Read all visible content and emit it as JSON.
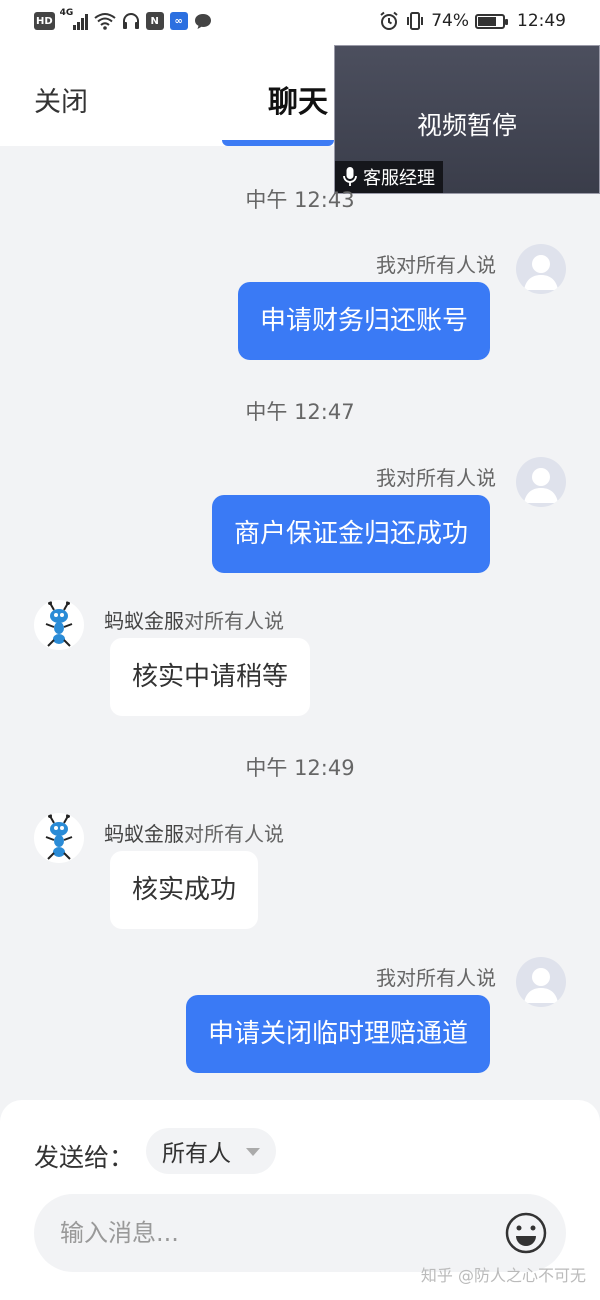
{
  "status_bar": {
    "hd": "HD",
    "net": "4G",
    "nfc": "N",
    "battery_percent": "74%",
    "battery_level": 0.74,
    "time": "12:49"
  },
  "header": {
    "close_label": "关闭",
    "title": "聊天"
  },
  "video": {
    "status": "视频暂停",
    "caption": "客服经理"
  },
  "messages": [
    {
      "type": "time",
      "text": "中午 12:43"
    },
    {
      "type": "self",
      "sender": "我对所有人说",
      "text": "申请财务归还账号"
    },
    {
      "type": "time",
      "text": "中午 12:47"
    },
    {
      "type": "self",
      "sender": "我对所有人说",
      "text": "商户保证金归还成功"
    },
    {
      "type": "other",
      "name": "蚂蚁金服",
      "suffix": "对所有人说",
      "text": "核实中请稍等"
    },
    {
      "type": "time",
      "text": "中午 12:49"
    },
    {
      "type": "other",
      "name": "蚂蚁金服",
      "suffix": "对所有人说",
      "text": "核实成功"
    },
    {
      "type": "self",
      "sender": "我对所有人说",
      "text": "申请关闭临时理赔通道"
    }
  ],
  "composer": {
    "send_to_label": "发送给：",
    "recipient": "所有人",
    "placeholder": "输入消息..."
  },
  "watermark": "知乎 @防人之心不可无",
  "colors": {
    "accent": "#3a7af5",
    "background": "#f2f3f5"
  }
}
